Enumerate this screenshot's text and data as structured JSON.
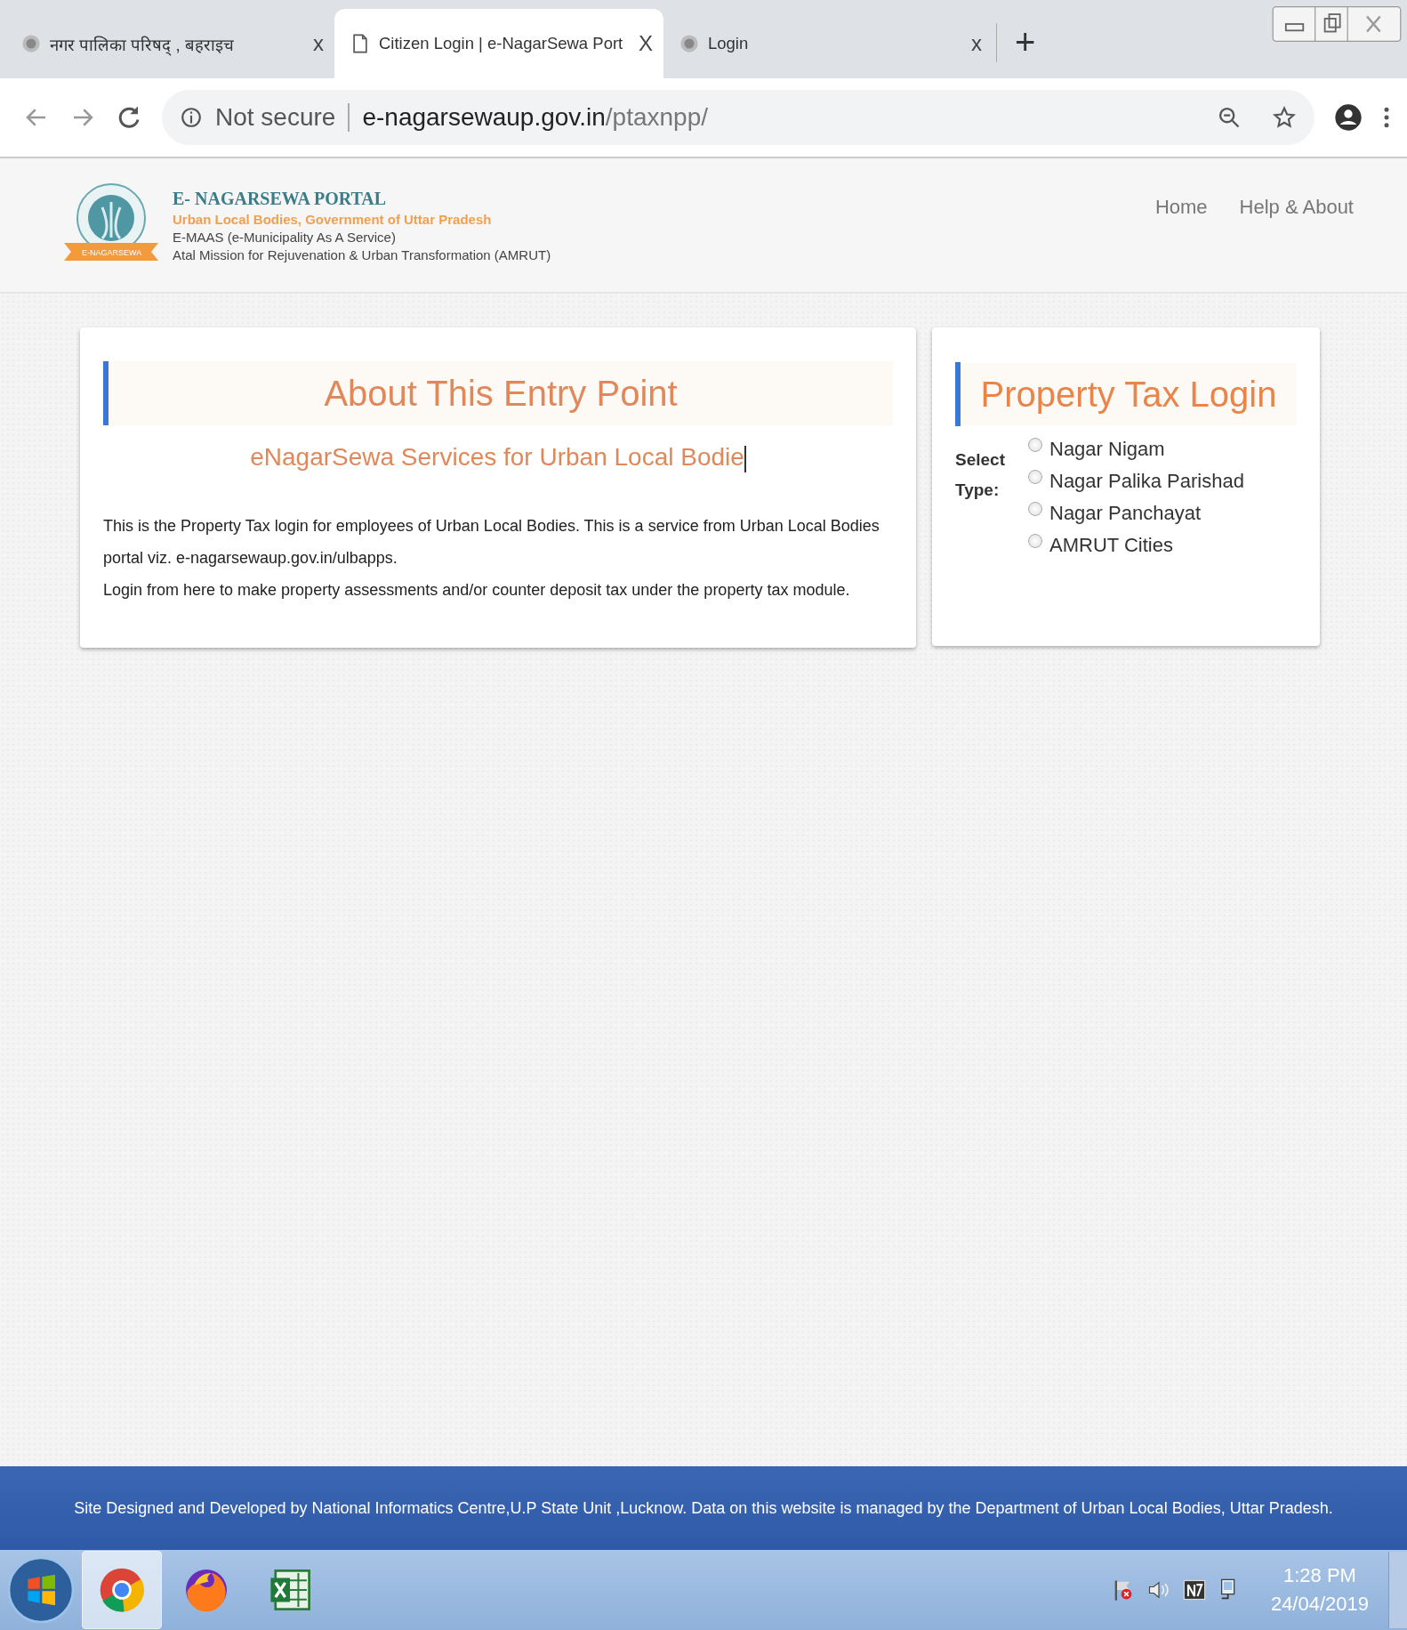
{
  "browser": {
    "tabs": [
      {
        "title": "नगर पालिका परिषद् , बहराइच",
        "kind": "emblem",
        "selected": false,
        "close": "x"
      },
      {
        "title": "Citizen Login | e-NagarSewa Port",
        "kind": "page",
        "selected": true,
        "close": "X"
      },
      {
        "title": "Login",
        "kind": "emblem",
        "selected": false,
        "close": "x"
      }
    ],
    "new_tab": "+",
    "security": "Not secure",
    "url_host": "e-nagarsewaup.gov.in",
    "url_path": "/ptaxnpp/"
  },
  "header": {
    "title": "E- NAGARSEWA PORTAL",
    "subtitle": "Urban Local Bodies, Government of Uttar Pradesh",
    "line_1": "E-MAAS (e-Municipality As A Service)",
    "line_2": "Atal Mission for Rejuvenation & Urban Transformation (AMRUT)",
    "logo_ribbon": "E-NAGARSEWA",
    "nav": [
      "Home",
      "Help & About"
    ]
  },
  "about": {
    "title": "About This Entry Point",
    "subtitle": "eNagarSewa Services for Urban Local Bodie",
    "paragraphs": [
      "This is the Property Tax login for employees of Urban Local Bodies. This is a service from Urban Local Bodies portal viz. e-nagarsewaup.gov.in/ulbapps.",
      "Login from here to make property assessments and/or counter deposit tax under the property tax module."
    ]
  },
  "login": {
    "title": "Property Tax Login",
    "select_label": "Select Type:",
    "options": [
      {
        "label": "Nagar Nigam",
        "selected": false
      },
      {
        "label": "Nagar Palika Parishad",
        "selected": false
      },
      {
        "label": "Nagar Panchayat",
        "selected": false
      },
      {
        "label": "AMRUT Cities",
        "selected": false
      }
    ]
  },
  "footer": "Site Designed and Developed by National Informatics Centre,U.P State Unit ,Lucknow. Data on this website is managed by the Department of Urban Local Bodies, Uttar Pradesh.",
  "taskbar": {
    "apps": [
      {
        "kind": "chrome",
        "selected": true
      },
      {
        "kind": "firefox",
        "selected": false
      },
      {
        "kind": "excel",
        "selected": false
      }
    ],
    "time": "1:28 PM",
    "date": "24/04/2019"
  }
}
